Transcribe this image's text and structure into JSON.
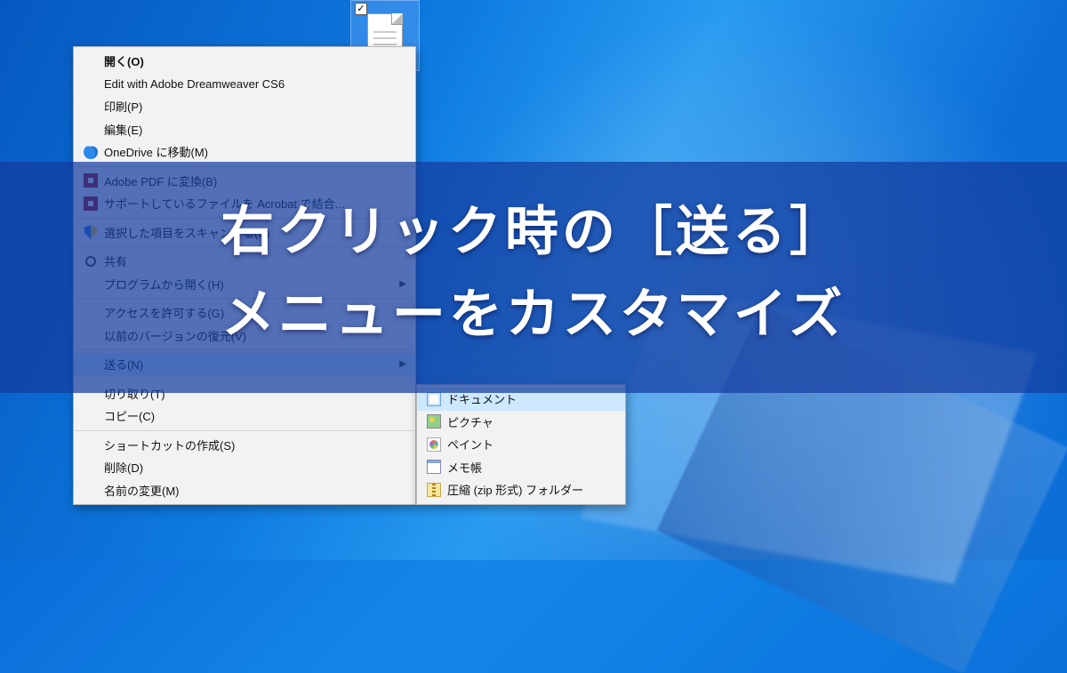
{
  "file_icon": {
    "checked": true
  },
  "context_menu": {
    "groups": [
      [
        {
          "label": "開く(O)",
          "bold": true
        },
        {
          "label": "Edit with Adobe Dreamweaver CS6"
        },
        {
          "label": "印刷(P)"
        },
        {
          "label": "編集(E)"
        },
        {
          "label": "OneDrive に移動(M)",
          "icon": "onedrive"
        }
      ],
      [
        {
          "label": "Adobe PDF に変換(B)",
          "icon": "pdf"
        },
        {
          "label": "サポートしているファイルを Acrobat で結合...",
          "icon": "pdf"
        }
      ],
      [
        {
          "label": "選択した項目をスキャンする(S)",
          "icon": "shield"
        }
      ],
      [
        {
          "label": "共有",
          "icon": "share"
        },
        {
          "label": "プログラムから開く(H)",
          "submenu": true
        }
      ],
      [
        {
          "label": "アクセスを許可する(G)",
          "submenu": true
        },
        {
          "label": "以前のバージョンの復元(V)"
        }
      ],
      [
        {
          "label": "送る(N)",
          "submenu": true,
          "selected": true
        }
      ],
      [
        {
          "label": "切り取り(T)"
        },
        {
          "label": "コピー(C)"
        }
      ],
      [
        {
          "label": "ショートカットの作成(S)"
        },
        {
          "label": "削除(D)"
        },
        {
          "label": "名前の変更(M)"
        }
      ]
    ]
  },
  "send_to_submenu": [
    {
      "label": "ドキュメント",
      "icon": "doc",
      "selected": true
    },
    {
      "label": "ピクチャ",
      "icon": "pic"
    },
    {
      "label": "ペイント",
      "icon": "paint"
    },
    {
      "label": "メモ帳",
      "icon": "note"
    },
    {
      "label": "圧縮 (zip 形式) フォルダー",
      "icon": "zip"
    }
  ],
  "overlay": {
    "line1": "右クリック時の［送る］",
    "line2": "メニューをカスタマイズ"
  }
}
